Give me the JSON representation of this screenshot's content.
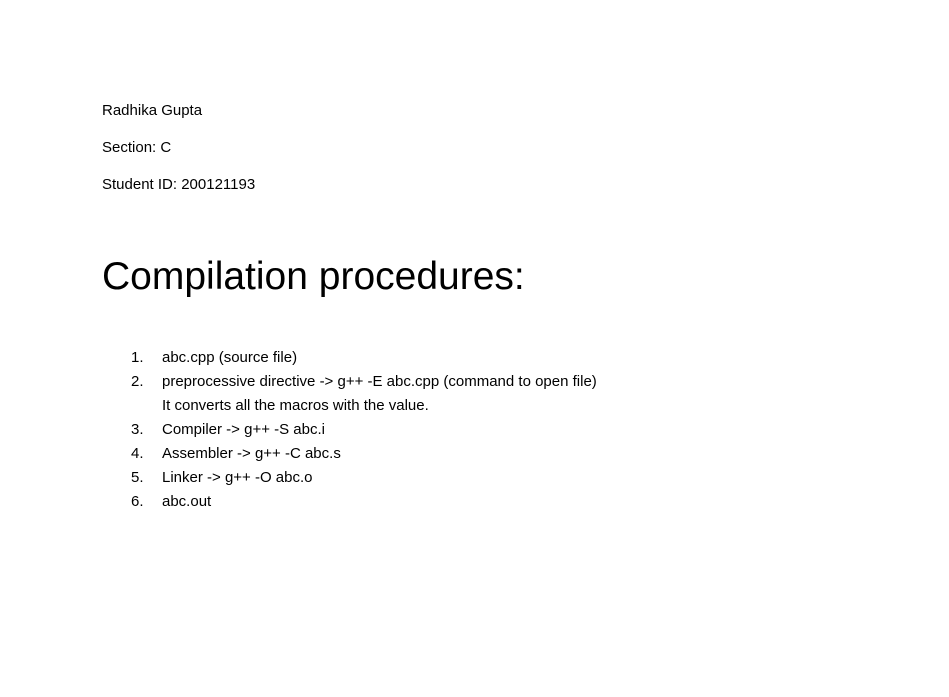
{
  "student": {
    "name": "Radhika Gupta",
    "section": "Section: C",
    "student_id": "Student ID: 200121193"
  },
  "heading": "Compilation procedures:",
  "steps": [
    {
      "number": "1.",
      "text": "abc.cpp (source file)"
    },
    {
      "number": "2.",
      "text": "preprocessive directive -> g++ -E abc.cpp (command to open file)",
      "note": "It converts all the macros with the value."
    },
    {
      "number": "3.",
      "text": "Compiler -> g++ -S abc.i"
    },
    {
      "number": "4.",
      "text": "Assembler -> g++ -C abc.s"
    },
    {
      "number": "5.",
      "text": "Linker -> g++ -O abc.o"
    },
    {
      "number": "6.",
      "text": "abc.out"
    }
  ]
}
